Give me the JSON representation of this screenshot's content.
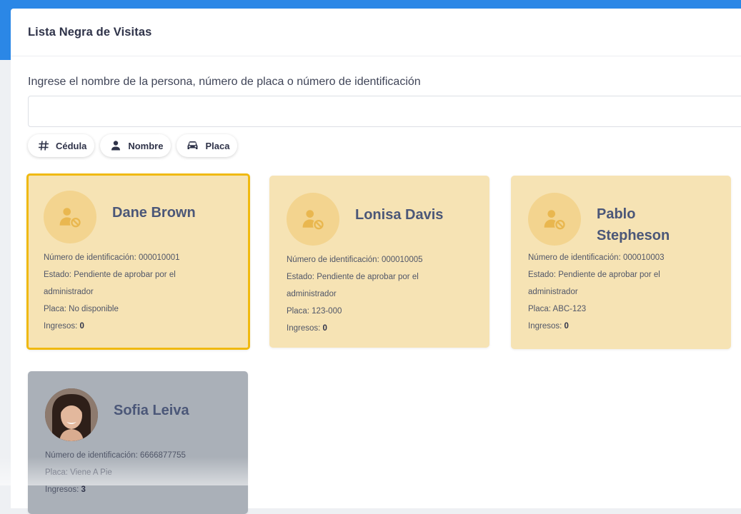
{
  "panel": {
    "title": "Lista Negra de Visitas"
  },
  "search": {
    "label": "Ingrese el nombre de la persona, número de placa o número de identificación",
    "value": "",
    "placeholder": ""
  },
  "filters": [
    {
      "label": "Cédula",
      "icon": "hash-icon"
    },
    {
      "label": "Nombre",
      "icon": "person-icon"
    },
    {
      "label": "Placa",
      "icon": "car-icon"
    }
  ],
  "colors": {
    "topbar": "#2b87e6",
    "card_pending": "#f6e3b4",
    "card_selected_border": "#f0b90f",
    "card_registered": "#aab0b8",
    "name_text": "#4b5778"
  },
  "visitors": [
    {
      "name": "Dane Brown",
      "avatar": "blocked-user-icon",
      "id_text": "Número de identificación: 000010001",
      "status_line1": "Estado: Pendiente de aprobar por el",
      "status_line2": "administrador",
      "plate_text": "Placa: No disponible",
      "entries_label": "Ingresos: ",
      "entries_value": "0",
      "selected": true
    },
    {
      "name": "Lonisa Davis",
      "avatar": "blocked-user-icon",
      "id_text": "Número de identificación: 000010005",
      "status_line1": "Estado: Pendiente de aprobar por el",
      "status_line2": "administrador",
      "plate_text": "Placa: 123-000",
      "entries_label": "Ingresos: ",
      "entries_value": "0"
    },
    {
      "name_line1": "Pablo",
      "name_line2": "Stepheson",
      "avatar": "blocked-user-icon",
      "id_text": "Número de identificación: 000010003",
      "status_line1": "Estado: Pendiente de aprobar por el",
      "status_line2": "administrador",
      "plate_text": "Placa: ABC-123",
      "entries_label": "Ingresos: ",
      "entries_value": "0"
    },
    {
      "name": "Sofia Leiva",
      "avatar": "profile-photo",
      "id_text": "Número de identificación: 6666877755",
      "plate_text": "Placa: Viene A Pie",
      "entries_label": "Ingresos: ",
      "entries_value": "3"
    }
  ]
}
